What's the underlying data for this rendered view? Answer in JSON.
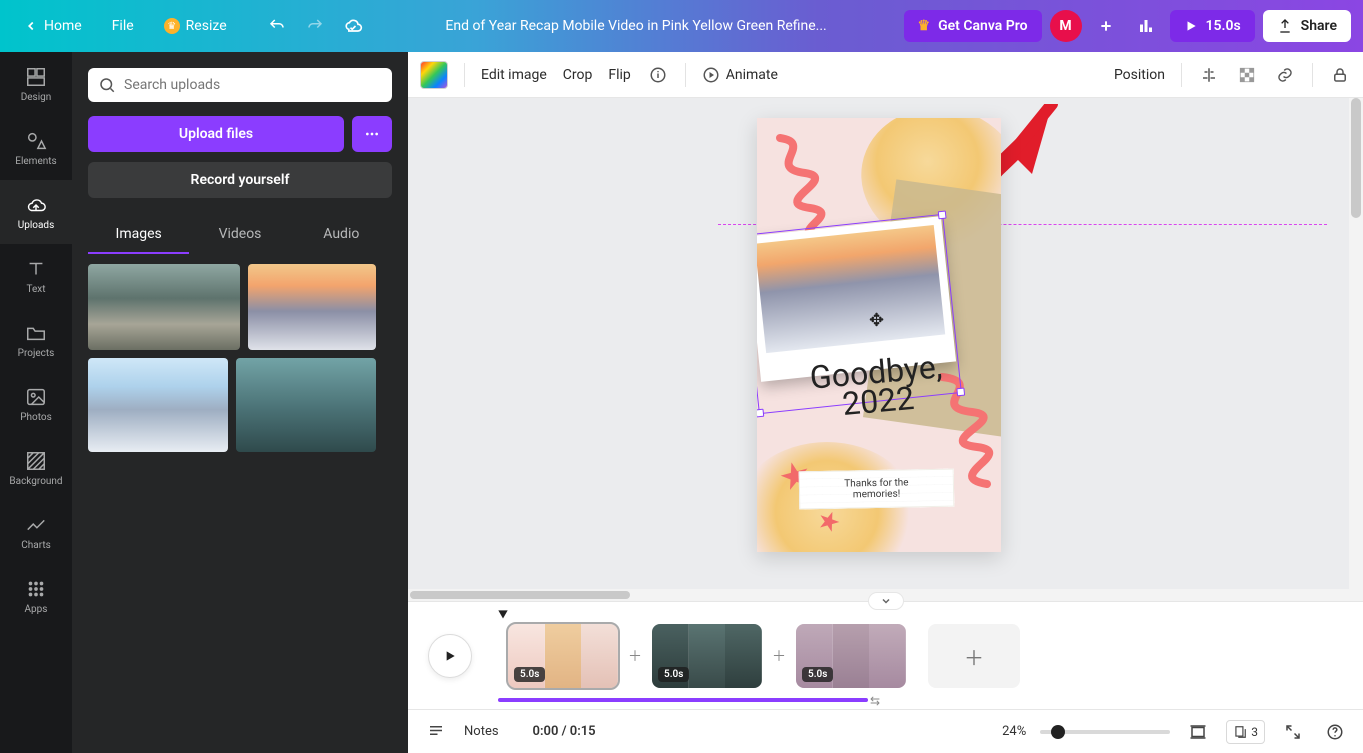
{
  "topbar": {
    "home": "Home",
    "file": "File",
    "resize": "Resize",
    "title": "End of Year Recap Mobile Video in Pink Yellow Green Refine...",
    "get_pro": "Get Canva Pro",
    "avatar_initial": "M",
    "duration": "15.0s",
    "share": "Share"
  },
  "rail": {
    "design": "Design",
    "elements": "Elements",
    "uploads": "Uploads",
    "text": "Text",
    "projects": "Projects",
    "photos": "Photos",
    "background": "Background",
    "charts": "Charts",
    "apps": "Apps"
  },
  "panel": {
    "search_placeholder": "Search uploads",
    "upload": "Upload files",
    "record": "Record yourself",
    "tabs": {
      "images": "Images",
      "videos": "Videos",
      "audio": "Audio"
    }
  },
  "ctx": {
    "edit_image": "Edit image",
    "crop": "Crop",
    "flip": "Flip",
    "animate": "Animate",
    "position": "Position"
  },
  "artboard": {
    "title_line1": "Goodbye,",
    "title_line2": "2022",
    "caption_line1": "Thanks for the",
    "caption_line2": "memories!"
  },
  "timeline": {
    "clips": [
      {
        "duration": "5.0s"
      },
      {
        "duration": "5.0s"
      },
      {
        "duration": "5.0s"
      }
    ]
  },
  "bottom": {
    "notes": "Notes",
    "time": "0:00 / 0:15",
    "zoom": "24%",
    "page_count": "3"
  }
}
